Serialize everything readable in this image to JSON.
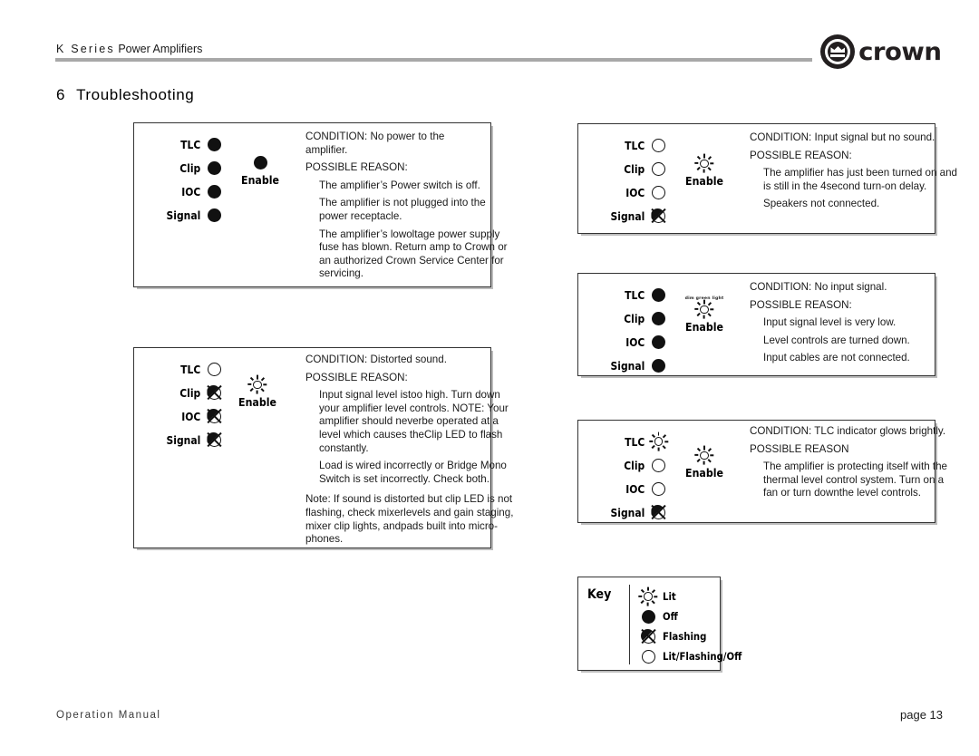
{
  "header": {
    "title_spaced": "K Series",
    "title_rest": " Power Amplifiers",
    "logo_word": "crown"
  },
  "section": {
    "number": "6",
    "title": "Troubleshooting"
  },
  "led_names": {
    "tlc": "TLC",
    "clip": "Clip",
    "ioc": "IOC",
    "signal": "Signal",
    "enable": "Enable"
  },
  "panels": [
    {
      "id": "no-power",
      "leds": [
        "off",
        "off",
        "off",
        "off"
      ],
      "enable": "off",
      "enable_note": "",
      "condition": "CONDITION: No power to the",
      "condition_line2": "amplifier.",
      "reason_header": "POSSIBLE REASON:",
      "reasons": [
        [
          "The amplifier’s Power switch is off."
        ],
        [
          "The amplifier is not plugged into the",
          "power receptacle."
        ],
        [
          "The amplifier’s lowoltage power supply",
          "fuse has blown. Return amp to Crown or",
          "an authorized Crown Service Center for",
          "servicing."
        ]
      ],
      "note": []
    },
    {
      "id": "distorted-sound",
      "leds": [
        "open",
        "flashing",
        "flashing",
        "flashing"
      ],
      "enable": "lit",
      "enable_note": "",
      "condition": "CONDITION: Distorted sound.",
      "condition_line2": "",
      "reason_header": "POSSIBLE REASON:",
      "reasons": [
        [
          "Input signal level istoo high. Turn down",
          "your amplifier level controls. NOTE: Your",
          "amplifier should neverbe operated at a",
          "level which causes theClip LED to flash",
          "constantly."
        ],
        [
          "Load is wired incorrectly or Bridge Mono",
          "Switch is set incorrectly. Check both."
        ]
      ],
      "note": [
        "Note: If sound is distorted but clip LED is not",
        "flashing, check mixerlevels and gain staging,",
        "mixer clip lights, andpads built into micro-",
        "phones."
      ]
    },
    {
      "id": "input-signal-no-sound",
      "leds": [
        "open",
        "open",
        "open",
        "flashing"
      ],
      "enable": "lit",
      "enable_note": "",
      "condition": "CONDITION: Input signal but no sound.",
      "condition_line2": "",
      "reason_header": "POSSIBLE REASON:",
      "reasons": [
        [
          "The amplifier has just been turned on and",
          "is still in the 4second turn-on delay."
        ],
        [
          "Speakers not connected."
        ]
      ],
      "note": []
    },
    {
      "id": "no-input-signal",
      "leds": [
        "off",
        "off",
        "off",
        "off"
      ],
      "enable": "lit",
      "enable_note": "dim green light",
      "condition": "CONDITION: No input signal.",
      "condition_line2": "",
      "reason_header": "POSSIBLE REASON:",
      "reasons": [
        [
          "Input signal level is very low."
        ],
        [
          "Level controls are turned down."
        ],
        [
          "Input cables are not connected."
        ]
      ],
      "note": []
    },
    {
      "id": "tlc-glows-brightly",
      "leds": [
        "lit",
        "open",
        "open",
        "flashing"
      ],
      "enable": "lit",
      "enable_note": "",
      "condition": "CONDITION: TLC indicator glows brightly.",
      "condition_line2": "",
      "reason_header": "POSSIBLE REASON",
      "reasons": [
        [
          "The amplifier is protecting itself with the",
          "thermal level control system. Turn on a",
          "fan or turn downthe level controls."
        ]
      ],
      "note": []
    }
  ],
  "key": {
    "label": "Key",
    "items": [
      {
        "glyph": "lit",
        "text": "Lit"
      },
      {
        "glyph": "off",
        "text": "Off"
      },
      {
        "glyph": "flashing",
        "text": "Flashing"
      },
      {
        "glyph": "open",
        "text": "Lit/Flashing/Off"
      }
    ]
  },
  "footer": {
    "left": "Operation Manual",
    "right": "page 13"
  }
}
